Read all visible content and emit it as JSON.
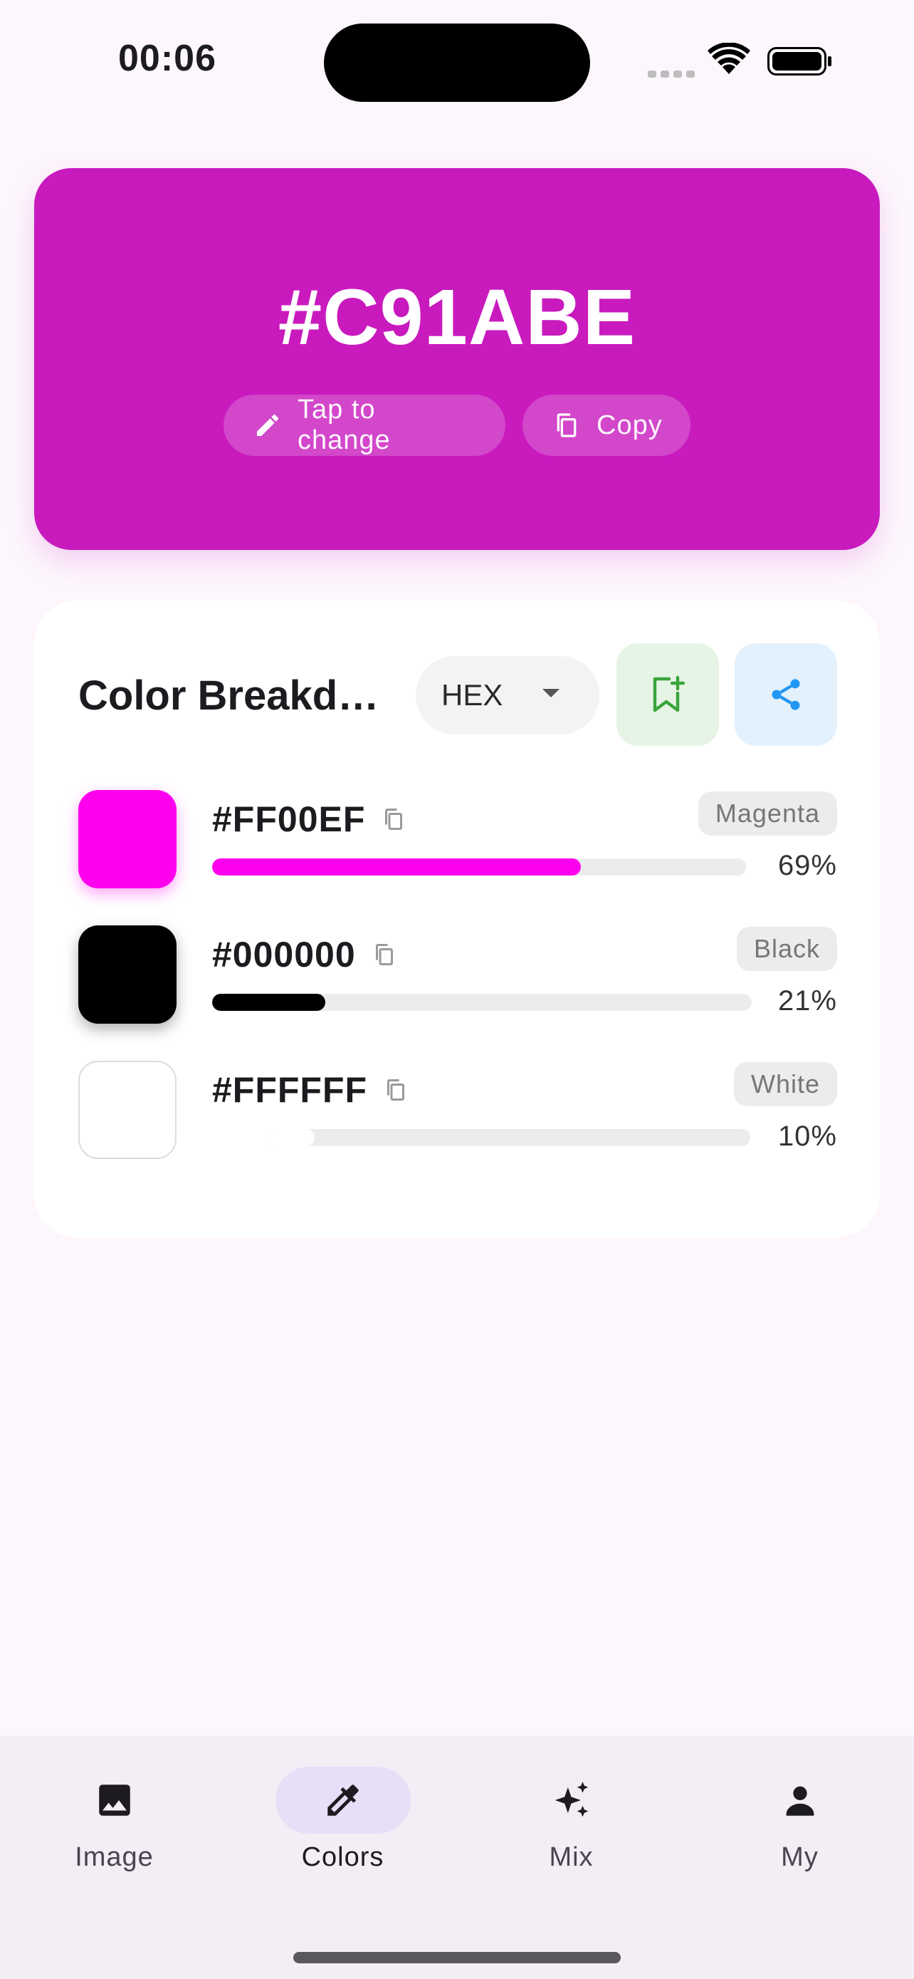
{
  "status_bar": {
    "time": "00:06"
  },
  "hero": {
    "hex": "#C91ABE",
    "background": "#C91ABE",
    "change_label": "Tap to change",
    "copy_label": "Copy"
  },
  "breakdown": {
    "title": "Color Breakdown",
    "format": "HEX",
    "rows": [
      {
        "hex": "#FF00EF",
        "name": "Magenta",
        "percent_label": "69%",
        "percent": 69,
        "color": "#FF00EF"
      },
      {
        "hex": "#000000",
        "name": "Black",
        "percent_label": "21%",
        "percent": 21,
        "color": "#000000"
      },
      {
        "hex": "#FFFFFF",
        "name": "White",
        "percent_label": "10%",
        "percent": 10,
        "color": "#FFFFFF"
      }
    ]
  },
  "nav": {
    "items": [
      {
        "label": "Image",
        "icon": "image-icon"
      },
      {
        "label": "Colors",
        "icon": "eyedropper-icon",
        "active": true
      },
      {
        "label": "Mix",
        "icon": "sparkle-icon"
      },
      {
        "label": "My",
        "icon": "person-icon"
      }
    ]
  }
}
